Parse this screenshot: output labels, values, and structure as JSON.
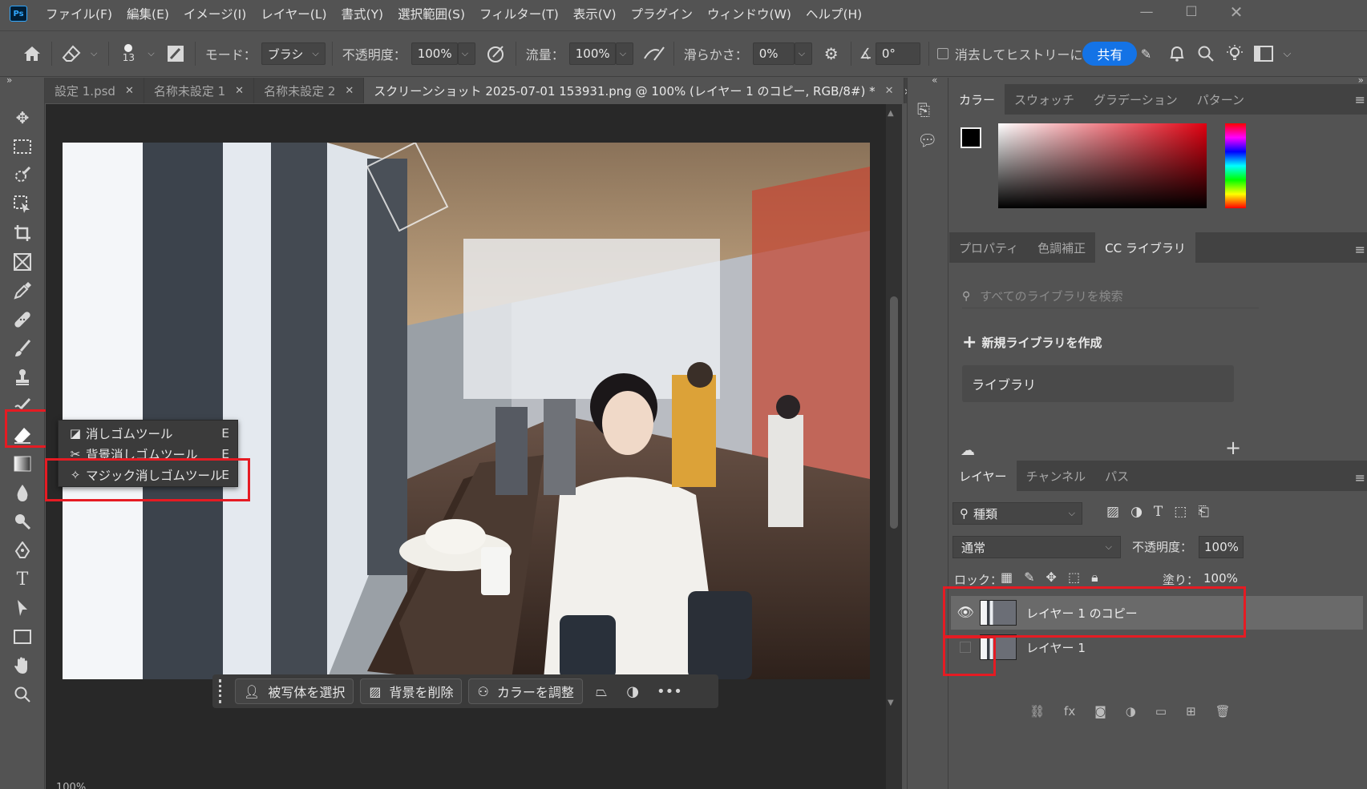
{
  "app": {
    "logo": "Ps"
  },
  "menubar": {
    "items": [
      "ファイル(F)",
      "編集(E)",
      "イメージ(I)",
      "レイヤー(L)",
      "書式(Y)",
      "選択範囲(S)",
      "フィルター(T)",
      "表示(V)",
      "プラグイン",
      "ウィンドウ(W)",
      "ヘルプ(H)"
    ]
  },
  "options": {
    "brush_size": "13",
    "mode_label": "モード：",
    "mode_value": "ブラシ",
    "opacity_label": "不透明度：",
    "opacity_value": "100%",
    "flow_label": "流量：",
    "flow_value": "100%",
    "smooth_label": "滑らかさ：",
    "smooth_value": "0%",
    "angle_value": "0°",
    "history_label": "消去してヒストリーに",
    "share_label": "共有"
  },
  "tabs": [
    {
      "label": "設定 1.psd"
    },
    {
      "label": "名称未設定 1"
    },
    {
      "label": "名称未設定 2"
    },
    {
      "label": "スクリーンショット 2025-07-01 153931.png @ 100% (レイヤー 1 のコピー, RGB/8#) *"
    }
  ],
  "flyout": {
    "items": [
      {
        "label": "消しゴムツール",
        "shortcut": "E"
      },
      {
        "label": "背景消しゴムツール",
        "shortcut": "E"
      },
      {
        "label": "マジック消しゴムツール",
        "shortcut": "E"
      }
    ]
  },
  "taskbar": {
    "select_subject": "被写体を選択",
    "remove_bg": "背景を削除",
    "adjust_color": "カラーを調整"
  },
  "color_panel": {
    "tabs": [
      "カラー",
      "スウォッチ",
      "グラデーション",
      "パターン"
    ],
    "active_tab": 0,
    "hue_color": "#e00010"
  },
  "props_panel": {
    "tabs": [
      "プロパティ",
      "色調補正",
      "CC ライブラリ"
    ],
    "active_tab": 2,
    "search_placeholder": "すべてのライブラリを検索",
    "new_library": "新規ライブラリを作成",
    "library_name": "ライブラリ"
  },
  "layers_panel": {
    "tabs": [
      "レイヤー",
      "チャンネル",
      "パス"
    ],
    "active_tab": 0,
    "filter_label": "種類",
    "blend_mode": "通常",
    "opacity_label": "不透明度：",
    "opacity_value": "100%",
    "lock_label": "ロック：",
    "fill_label": "塗り：",
    "fill_value": "100%",
    "layers": [
      {
        "name": "レイヤー 1 のコピー",
        "visible": true,
        "selected": true
      },
      {
        "name": "レイヤー 1",
        "visible": false,
        "selected": false
      }
    ]
  },
  "status": {
    "zoom": "100%"
  },
  "highlight_color": "#e51b23"
}
